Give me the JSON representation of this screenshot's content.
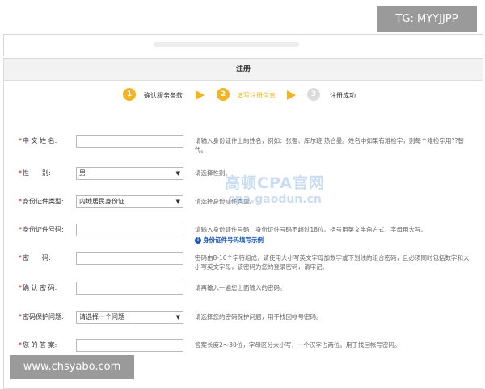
{
  "watermarks": {
    "tg": "TG: MYYJJPP",
    "center_cn": "高顿CPA官网",
    "center_en": "cpa.gaodun.cn",
    "url": "www.chsyabo.com"
  },
  "panel": {
    "title": "注册"
  },
  "steps": [
    {
      "number": "1",
      "label": "确认服务条款",
      "state": "done",
      "color": "#f3b423"
    },
    {
      "number": "2",
      "label": "填写注册信息",
      "state": "active",
      "color": "#f3b423"
    },
    {
      "number": "3",
      "label": "注册成功",
      "state": "pending",
      "color": "#dcdcdc"
    }
  ],
  "form": {
    "name": {
      "label": "中 文 姓 名:",
      "value": "",
      "help": "请输入身份证件上的姓名，例如：张强、库尔班·热合曼。姓名中如果有难检字，则每个难检字用??替代。"
    },
    "gender": {
      "label": "性　　别:",
      "value": "男",
      "help": "请选择性别。"
    },
    "id_type": {
      "label": "身份证件类型:",
      "value": "内地居民身份证",
      "help": "请选择身份证件类型。"
    },
    "id_number": {
      "label": "身份证件号码:",
      "value": "",
      "help": "请输入身份证件号码，身份证件号码不超过18位。括号用英文半角方式，字母用大写。",
      "link": "身份证件号码填写示例"
    },
    "password": {
      "label": "密　　码:",
      "value": "",
      "help": "密码由8-16个字符组成，请使用大小写英文字母加数字或下划线的组合密码，且必须同时包括数字和大小写英文字母，该密码为您的登录密码，请牢记。"
    },
    "confirm_password": {
      "label": "确 认 密 码:",
      "value": "",
      "help": "请再输入一遍您上面输入的密码。"
    },
    "security_question": {
      "label": "密码保护问题:",
      "value": "请选择一个问题",
      "help": "请选择您的密码保护问题，用于找回帐号密码。"
    },
    "security_answer": {
      "label": "您 的 答 案:",
      "value": "",
      "help": "答案长度2～30位，字母区分大小写，一个汉字占两位。用于找回帐号密码。"
    }
  },
  "colors": {
    "accent": "#f3b423",
    "active_step_text": "#f3b423",
    "required": "#dd0000",
    "link": "#1a56b5"
  }
}
